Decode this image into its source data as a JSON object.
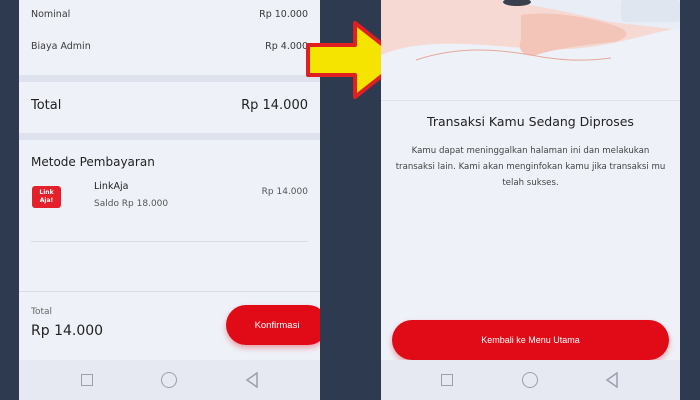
{
  "left": {
    "rows": [
      {
        "label": "Nominal",
        "value": "Rp 10.000"
      },
      {
        "label": "Biaya Admin",
        "value": "Rp 4.000"
      }
    ],
    "total_label": "Total",
    "total_value": "Rp 14.000",
    "payment_section_title": "Metode Pembayaran",
    "payment": {
      "icon_text": "Link Aja!",
      "name": "LinkAja",
      "saldo": "Saldo Rp 18.000",
      "amount": "Rp 14.000"
    },
    "bottom_total_label": "Total",
    "bottom_total_value": "Rp 14.000",
    "confirm_label": "Konfirmasi"
  },
  "right": {
    "title": "Transaksi Kamu Sedang Diproses",
    "description": "Kamu dapat meninggalkan halaman ini dan melakukan transaksi lain. Kami akan menginfokan kamu jika transaksi mu telah sukses.",
    "back_label": "Kembali ke Menu Utama"
  },
  "colors": {
    "accent": "#e00b17",
    "arrow_fill": "#f5e400",
    "arrow_stroke": "#e02020"
  },
  "icons": [
    "linkaja-logo-icon",
    "square-nav-icon",
    "circle-nav-icon",
    "back-triangle-nav-icon",
    "arrow-right-icon"
  ]
}
